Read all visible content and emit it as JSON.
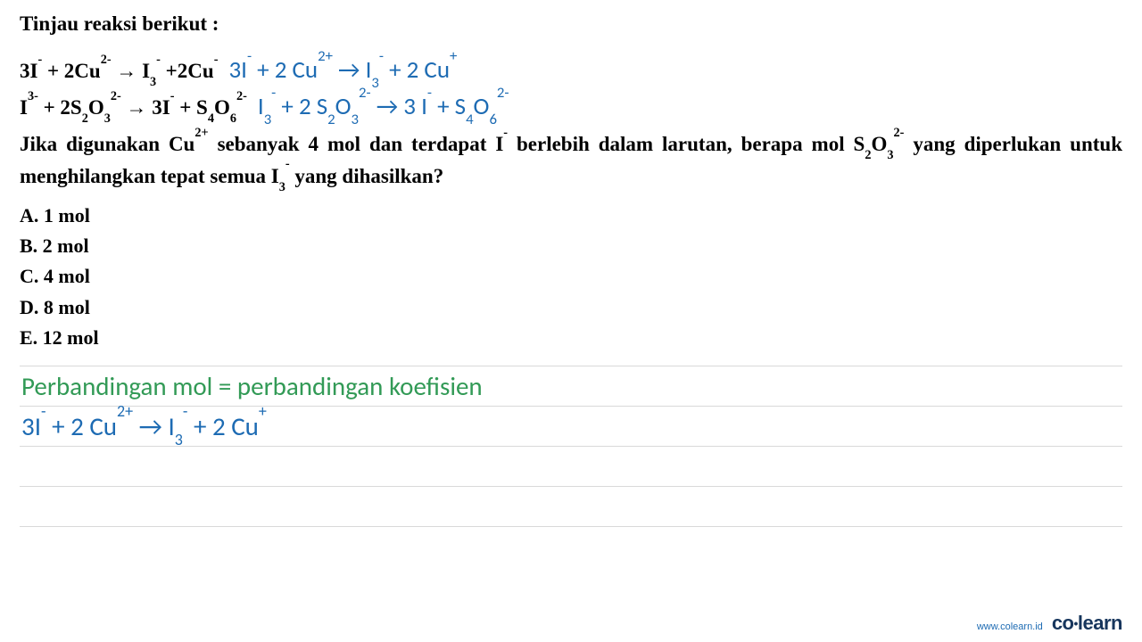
{
  "prompt": "Tinjau reaksi berikut :",
  "reactions": [
    {
      "original_html": "3I<sup>-</sup> + 2Cu<sup>2-</sup> → I<sub>3</sub><sup>-</sup> +2Cu<sup>-</sup>",
      "annotation_html": "3I<sup>-</sup> + 2 Cu<sup>2+</sup> → I<sub>3</sub><sup>-</sup> + 2 Cu<sup>+</sup>"
    },
    {
      "original_html": "I<sup>3-</sup> + 2S<sub>2</sub>O<sub>3</sub><sup>2-</sup> → 3I<sup>-</sup> + S<sub>4</sub>O<sub>6</sub><sup>2-</sup>",
      "annotation_html": "I<sub>3</sub><sup>-</sup> + 2 S<sub>2</sub>O<sub>3</sub><sup>2-</sup> → 3 I<sup>-</sup> + S<sub>4</sub>O<sub>6</sub><sup>2-</sup>"
    }
  ],
  "question_html": "Jika digunakan Cu<sup>2+</sup> sebanyak 4 mol dan terdapat I<sup>-</sup> berlebih dalam larutan, berapa mol S<sub>2</sub>O<sub>3</sub><sup>2-</sup> yang diperlukan untuk menghilangkan tepat semua I<sub>3</sub><sup>-</sup> yang dihasilkan?",
  "options": [
    "A. 1 mol",
    "B. 2 mol",
    "C. 4 mol",
    "D. 8 mol",
    "E. 12 mol"
  ],
  "work": {
    "line1_text": "Perbandingan mol = perbandingan koefisien",
    "line1_color": "green",
    "line2_html": "3I<sup>-</sup> + 2 Cu<sup>2+</sup> → I<sub>3</sub><sup>-</sup> + 2 Cu<sup>+</sup>",
    "line2_color": "blue"
  },
  "footer": {
    "url": "www.colearn.id",
    "logo_html": "co<span class=\"dot\">•</span>learn"
  }
}
